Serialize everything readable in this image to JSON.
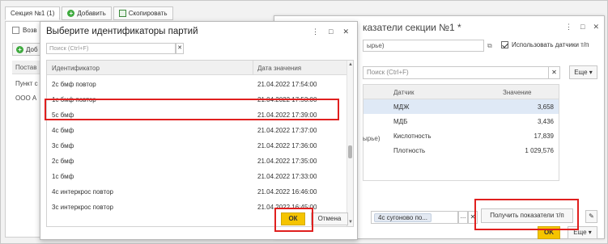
{
  "section_bar": {
    "tab_label": "Секция №1 (1)",
    "add_label": "Добавить",
    "copy_label": "Скопировать"
  },
  "background_left": {
    "checkbox_label": "Возв",
    "add_label": "Доб",
    "col_supplier": "Постав",
    "cell_point": "Пункт с",
    "cell_org": "ООО А"
  },
  "background_form": {
    "title": "казатели секции №1 *",
    "field_top": "ырье)",
    "use_sensors_label": "Использовать датчики т/п",
    "search_placeholder": "Поиск (Ctrl+F)",
    "more_label": "Еще",
    "col_sensor": "Датчик",
    "col_value": "Значение",
    "rows": [
      {
        "prefix": "",
        "sensor": "МДЖ",
        "value": "3,658"
      },
      {
        "prefix": "",
        "sensor": "МДБ",
        "value": "3,436"
      },
      {
        "prefix": "ырье)",
        "sensor": "Кислотность",
        "value": "17,839"
      },
      {
        "prefix": "",
        "sensor": "Плотность",
        "value": "1 029,576"
      }
    ],
    "bottom_chip": "4с сугоново по...",
    "bottom_dots": "...",
    "get_button": "Получить показатели т/п",
    "ok_label": "OK",
    "more2_label": "Еще"
  },
  "dialog": {
    "title": "Выберите идентификаторы партий",
    "search_placeholder": "Поиск (Ctrl+F)",
    "col_id": "Идентификатор",
    "col_date": "Дата значения",
    "rows": [
      {
        "id": "2с бмф повтор",
        "date": "21.04.2022 17:54:00"
      },
      {
        "id": "1с бмф повтор",
        "date": "21.04.2022 17:53:00"
      },
      {
        "id": "5с бмф",
        "date": "21.04.2022 17:39:00"
      },
      {
        "id": "4с бмф",
        "date": "21.04.2022 17:37:00"
      },
      {
        "id": "3с бмф",
        "date": "21.04.2022 17:36:00"
      },
      {
        "id": "2с бмф",
        "date": "21.04.2022 17:35:00"
      },
      {
        "id": "1с бмф",
        "date": "21.04.2022 17:33:00"
      },
      {
        "id": "4с интеркрос повтор",
        "date": "21.04.2022 16:46:00"
      },
      {
        "id": "3с интеркрос повтор",
        "date": "21.04.2022 16:45:00"
      }
    ],
    "ok_label": "ОК",
    "cancel_label": "Отмена"
  },
  "colors": {
    "highlight": "#e0201f",
    "primary_button": "#f5c400",
    "selected_row": "#dfe9f6"
  }
}
